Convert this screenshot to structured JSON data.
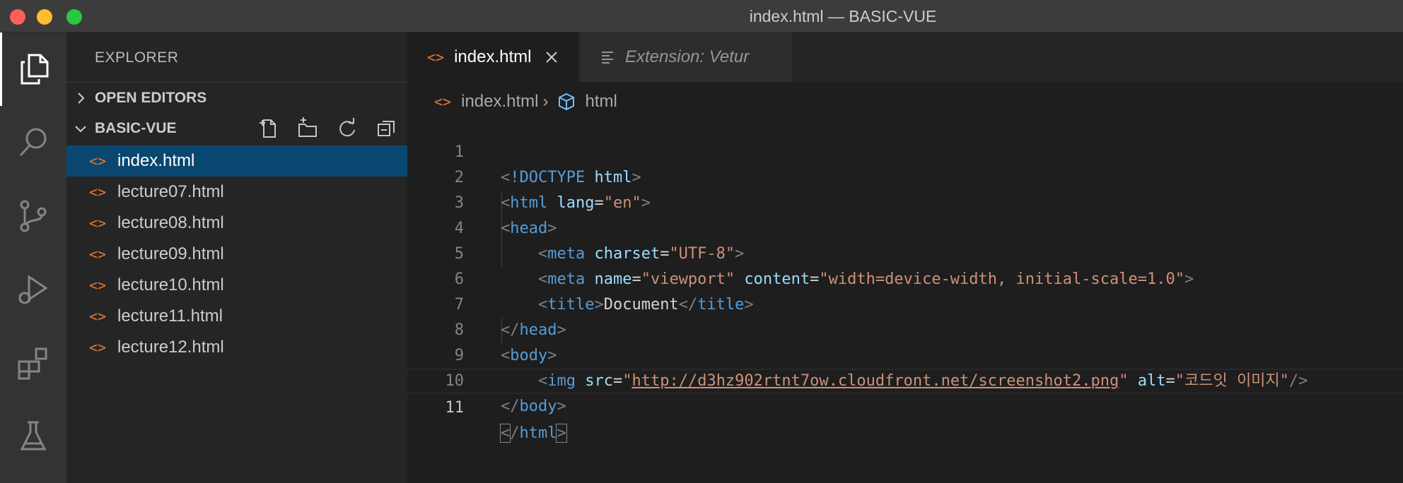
{
  "window": {
    "title": "index.html — BASIC-VUE"
  },
  "activity_bar": {
    "items": [
      {
        "icon": "files-icon",
        "active": true
      },
      {
        "icon": "search-icon",
        "active": false
      },
      {
        "icon": "source-control-icon",
        "active": false
      },
      {
        "icon": "run-debug-icon",
        "active": false
      },
      {
        "icon": "extensions-icon",
        "active": false
      },
      {
        "icon": "testing-flask-icon",
        "active": false
      }
    ]
  },
  "sidebar": {
    "title": "EXPLORER",
    "open_editors_label": "OPEN EDITORS",
    "folder_label": "BASIC-VUE",
    "files": [
      {
        "name": "index.html",
        "selected": true
      },
      {
        "name": "lecture07.html",
        "selected": false
      },
      {
        "name": "lecture08.html",
        "selected": false
      },
      {
        "name": "lecture09.html",
        "selected": false
      },
      {
        "name": "lecture10.html",
        "selected": false
      },
      {
        "name": "lecture11.html",
        "selected": false
      },
      {
        "name": "lecture12.html",
        "selected": false
      }
    ]
  },
  "editor": {
    "tabs": [
      {
        "label": "index.html",
        "active": true
      },
      {
        "label": "Extension: Vetur",
        "active": false
      }
    ],
    "breadcrumb": {
      "file": "index.html",
      "symbol": "html"
    },
    "line_numbers": [
      "1",
      "2",
      "3",
      "4",
      "5",
      "6",
      "7",
      "8",
      "9",
      "10",
      "11"
    ],
    "code": {
      "l1_doctype": "!DOCTYPE",
      "l1_html": "html",
      "html_tag": "html",
      "lang_attr": "lang",
      "lang_val": "\"en\"",
      "head_tag": "head",
      "meta_tag": "meta",
      "charset_attr": "charset",
      "charset_val": "\"UTF-8\"",
      "name_attr": "name",
      "name_val": "\"viewport\"",
      "content_attr": "content",
      "content_val": "\"width=device-width, initial-scale=1.0\"",
      "title_tag": "title",
      "title_text": "Document",
      "body_tag": "body",
      "img_tag": "img",
      "src_attr": "src",
      "src_val": "http://d3hz902rtnt7ow.cloudfront.net/screenshot2.png",
      "alt_attr": "alt",
      "alt_val": "\"코드잇 이미지\""
    }
  },
  "colors": {
    "accent_file_icon": "#e37933",
    "selection": "#094771",
    "tag": "#569cd6",
    "attribute": "#9cdcfe",
    "string": "#ce9178"
  }
}
